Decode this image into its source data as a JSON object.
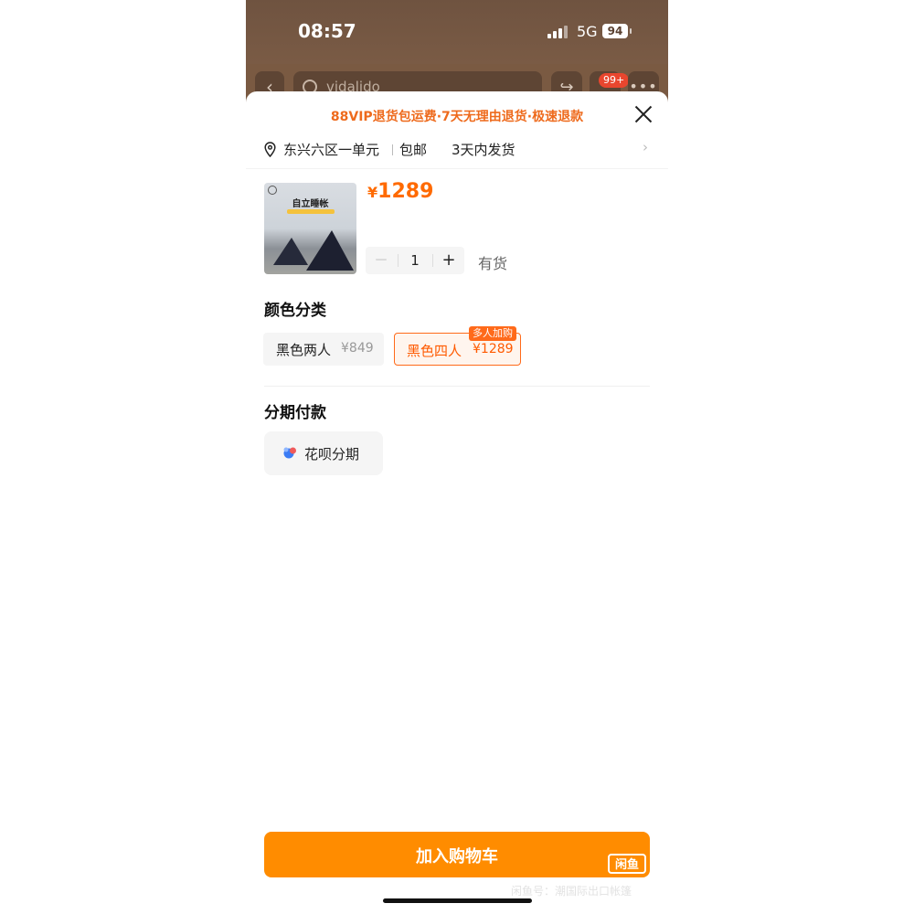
{
  "status_bar": {
    "time": "08:57",
    "network": "5G",
    "battery": "94"
  },
  "topbar": {
    "search_text": "vidalido",
    "cart_badge": "99+"
  },
  "banner": "88VIP退货包运费·7天无理由退货·极速退款",
  "address": {
    "location": "东兴六区一单元",
    "shipping": "包邮",
    "delivery": "3天内发货"
  },
  "product": {
    "thumb_title": "自立睡帐",
    "currency": "¥",
    "price": "1289",
    "quantity": "1",
    "stock": "有货",
    "minus": "－",
    "plus": "+"
  },
  "color_section": {
    "title": "颜色分类",
    "options": [
      {
        "name": "黑色两人",
        "price": "¥849",
        "selected": false
      },
      {
        "name": "黑色四人",
        "price": "¥1289",
        "selected": true,
        "badge": "多人加购"
      }
    ]
  },
  "installment_section": {
    "title": "分期付款",
    "option": "花呗分期"
  },
  "add_to_cart": "加入购物车",
  "watermark": {
    "logo": "闲鱼",
    "text": "闲鱼号：潮国际出口帐篷"
  },
  "colors": {
    "accent": "#ff6a00",
    "button": "#ff8c00",
    "banner": "#ee6a1c"
  }
}
